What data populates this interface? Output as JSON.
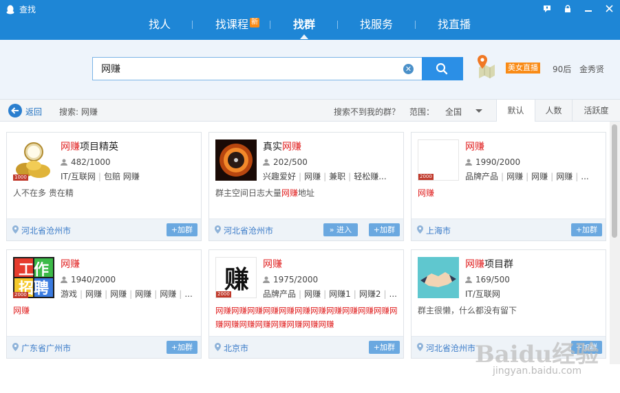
{
  "window": {
    "title": "查找"
  },
  "tabs": [
    {
      "label": "找人"
    },
    {
      "label": "找课程",
      "badge": "新"
    },
    {
      "label": "找群"
    },
    {
      "label": "找服务"
    },
    {
      "label": "找直播"
    }
  ],
  "search": {
    "query": "网赚"
  },
  "promo": {
    "live_label": "美女直播",
    "tags": [
      "90后",
      "金秀贤"
    ]
  },
  "filter": {
    "back_label": "返回",
    "summary": "搜索: 网赚",
    "not_found": "搜索不到我的群？",
    "range_label": "范围：",
    "range_value": "全国",
    "sort_tabs": [
      "默认",
      "人数",
      "活跃度"
    ]
  },
  "cards": [
    {
      "name_hl": "网赚",
      "name_rest": "项目精英",
      "members": "482/1000",
      "tags": [
        "IT/互联网",
        "包赔 网赚"
      ],
      "desc": "人不在多 贵在精",
      "desc_red": false,
      "location": "河北省沧州市",
      "join_label": "+加群",
      "level": "1000"
    },
    {
      "name_pre": "真实",
      "name_hl": "网赚",
      "members": "202/500",
      "tags": [
        "兴趣爱好",
        "网赚",
        "兼职",
        "轻松赚..."
      ],
      "desc_pre": "群主空间日志大量",
      "desc_hl": "网赚",
      "desc_post": "地址",
      "desc_red": false,
      "location": "河北省沧州市",
      "enter_label": "» 进入",
      "join_label": "+加群"
    },
    {
      "name_hl": "网赚",
      "members": "1990/2000",
      "tags": [
        "品牌产品",
        "网赚",
        "网赚",
        "网赚",
        "..."
      ],
      "desc": "网赚",
      "desc_red": true,
      "location": "上海市",
      "join_label": "+加群",
      "level": "2000"
    },
    {
      "name_hl": "网赚",
      "members": "1940/2000",
      "tags": [
        "游戏",
        "网赚",
        "网赚",
        "网赚",
        "网赚",
        "..."
      ],
      "desc": "网赚",
      "desc_red": true,
      "location": "广东省广州市",
      "join_label": "+加群",
      "level": "2000",
      "avatar_text": [
        "工作",
        "招聘"
      ]
    },
    {
      "name_hl": "网赚",
      "members": "1975/2000",
      "tags": [
        "品牌产品",
        "网赚",
        "网赚1",
        "网赚2",
        "..."
      ],
      "desc": "网赚网赚网赚网赚网赚网赚网赚网赚网赚网赚网赚网赚网赚网赚网赚网赚网赚网赚网赚",
      "desc_red": true,
      "location": "北京市",
      "join_label": "+加群",
      "level": "2000",
      "avatar_text": "赚"
    },
    {
      "name_hl": "网赚",
      "name_rest": "项目群",
      "members": "169/500",
      "tags": [
        "IT/互联网"
      ],
      "desc": "群主很懒，什么都没有留下",
      "desc_red": false,
      "location": "河北省沧州市",
      "join_label": "+加群"
    }
  ],
  "watermark": {
    "brand": "Baidu经验",
    "url": "jingyan.baidu.com"
  },
  "colors": {
    "header": "#1e86d6",
    "accent": "#2b8fe6",
    "highlight": "#e02020",
    "badge": "#f98b16"
  }
}
